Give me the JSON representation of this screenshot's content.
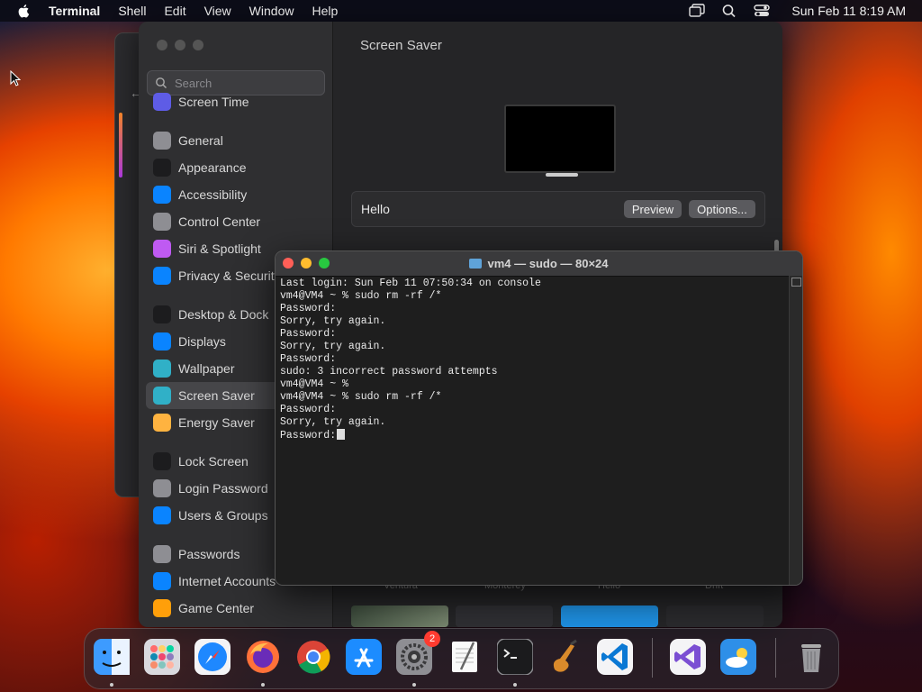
{
  "menubar": {
    "app_name": "Terminal",
    "menus": [
      "Shell",
      "Edit",
      "View",
      "Window",
      "Help"
    ],
    "clock": "Sun Feb 11  8:19 AM",
    "icons": [
      "screen-mirroring-icon",
      "search-icon",
      "control-center-icon"
    ]
  },
  "settings": {
    "search_placeholder": "Search",
    "page_title": "Screen Saver",
    "sidebar": [
      {
        "label": "Screen Time",
        "icon": "hourglass-icon",
        "color": "#5e5ce6"
      },
      {
        "label": "General",
        "icon": "gear-icon",
        "color": "#8e8e93"
      },
      {
        "label": "Appearance",
        "icon": "appearance-icon",
        "color": "#1c1c1e"
      },
      {
        "label": "Accessibility",
        "icon": "accessibility-icon",
        "color": "#0a84ff"
      },
      {
        "label": "Control Center",
        "icon": "control-center-icon",
        "color": "#8e8e93"
      },
      {
        "label": "Siri & Spotlight",
        "icon": "siri-icon",
        "color": "#bf5af2"
      },
      {
        "label": "Privacy & Security",
        "icon": "hand-icon",
        "color": "#0a84ff"
      },
      {
        "label": "Desktop & Dock",
        "icon": "desktop-icon",
        "color": "#1c1c1e"
      },
      {
        "label": "Displays",
        "icon": "displays-icon",
        "color": "#0a84ff"
      },
      {
        "label": "Wallpaper",
        "icon": "wallpaper-icon",
        "color": "#30b0c7"
      },
      {
        "label": "Screen Saver",
        "icon": "screen-saver-icon",
        "color": "#30b0c7"
      },
      {
        "label": "Energy Saver",
        "icon": "lightbulb-icon",
        "color": "#ffb340"
      },
      {
        "label": "Lock Screen",
        "icon": "lock-icon",
        "color": "#1c1c1e"
      },
      {
        "label": "Login Password",
        "icon": "lock-icon",
        "color": "#8e8e93"
      },
      {
        "label": "Users & Groups",
        "icon": "users-icon",
        "color": "#0a84ff"
      },
      {
        "label": "Passwords",
        "icon": "key-icon",
        "color": "#8e8e93"
      },
      {
        "label": "Internet Accounts",
        "icon": "at-icon",
        "color": "#0a84ff"
      },
      {
        "label": "Game Center",
        "icon": "game-center-icon",
        "color": "#ff9f0a"
      }
    ],
    "selected": "Screen Saver",
    "screen_saver_name": "Hello",
    "preview_button": "Preview",
    "options_button": "Options...",
    "thumbnail_labels": [
      "Ventura",
      "Monterey",
      "Hello",
      "Drift"
    ]
  },
  "terminal": {
    "title": "vm4 — sudo — 80×24",
    "lines": [
      "Last login: Sun Feb 11 07:50:34 on console",
      "vm4@VM4 ~ % sudo rm -rf /*",
      "Password:",
      "Sorry, try again.",
      "Password:",
      "Sorry, try again.",
      "Password:",
      "sudo: 3 incorrect password attempts",
      "vm4@VM4 ~ %",
      "vm4@VM4 ~ % sudo rm -rf /*",
      "Password:",
      "Sorry, try again.",
      "Password:"
    ]
  },
  "dock": {
    "apps": [
      {
        "name": "Finder",
        "icon": "finder-icon",
        "running": true
      },
      {
        "name": "Launchpad",
        "icon": "launchpad-icon",
        "running": false
      },
      {
        "name": "Safari",
        "icon": "safari-icon",
        "running": false
      },
      {
        "name": "Firefox",
        "icon": "firefox-icon",
        "running": true
      },
      {
        "name": "Chrome",
        "icon": "chrome-icon",
        "running": false
      },
      {
        "name": "App Store",
        "icon": "app-store-icon",
        "running": false
      },
      {
        "name": "System Settings",
        "icon": "system-settings-icon",
        "running": true,
        "badge": "2"
      },
      {
        "name": "TextEdit",
        "icon": "textedit-icon",
        "running": false
      },
      {
        "name": "Terminal",
        "icon": "terminal-icon",
        "running": true
      },
      {
        "name": "GarageBand",
        "icon": "garageband-icon",
        "running": false
      },
      {
        "name": "Visual Studio Code",
        "icon": "vscode-icon",
        "running": false
      },
      {
        "name": "Visual Studio",
        "icon": "visual-studio-icon",
        "running": false
      },
      {
        "name": "Weather",
        "icon": "weather-icon",
        "running": false
      },
      {
        "name": "Trash",
        "icon": "trash-icon",
        "running": false
      }
    ]
  }
}
